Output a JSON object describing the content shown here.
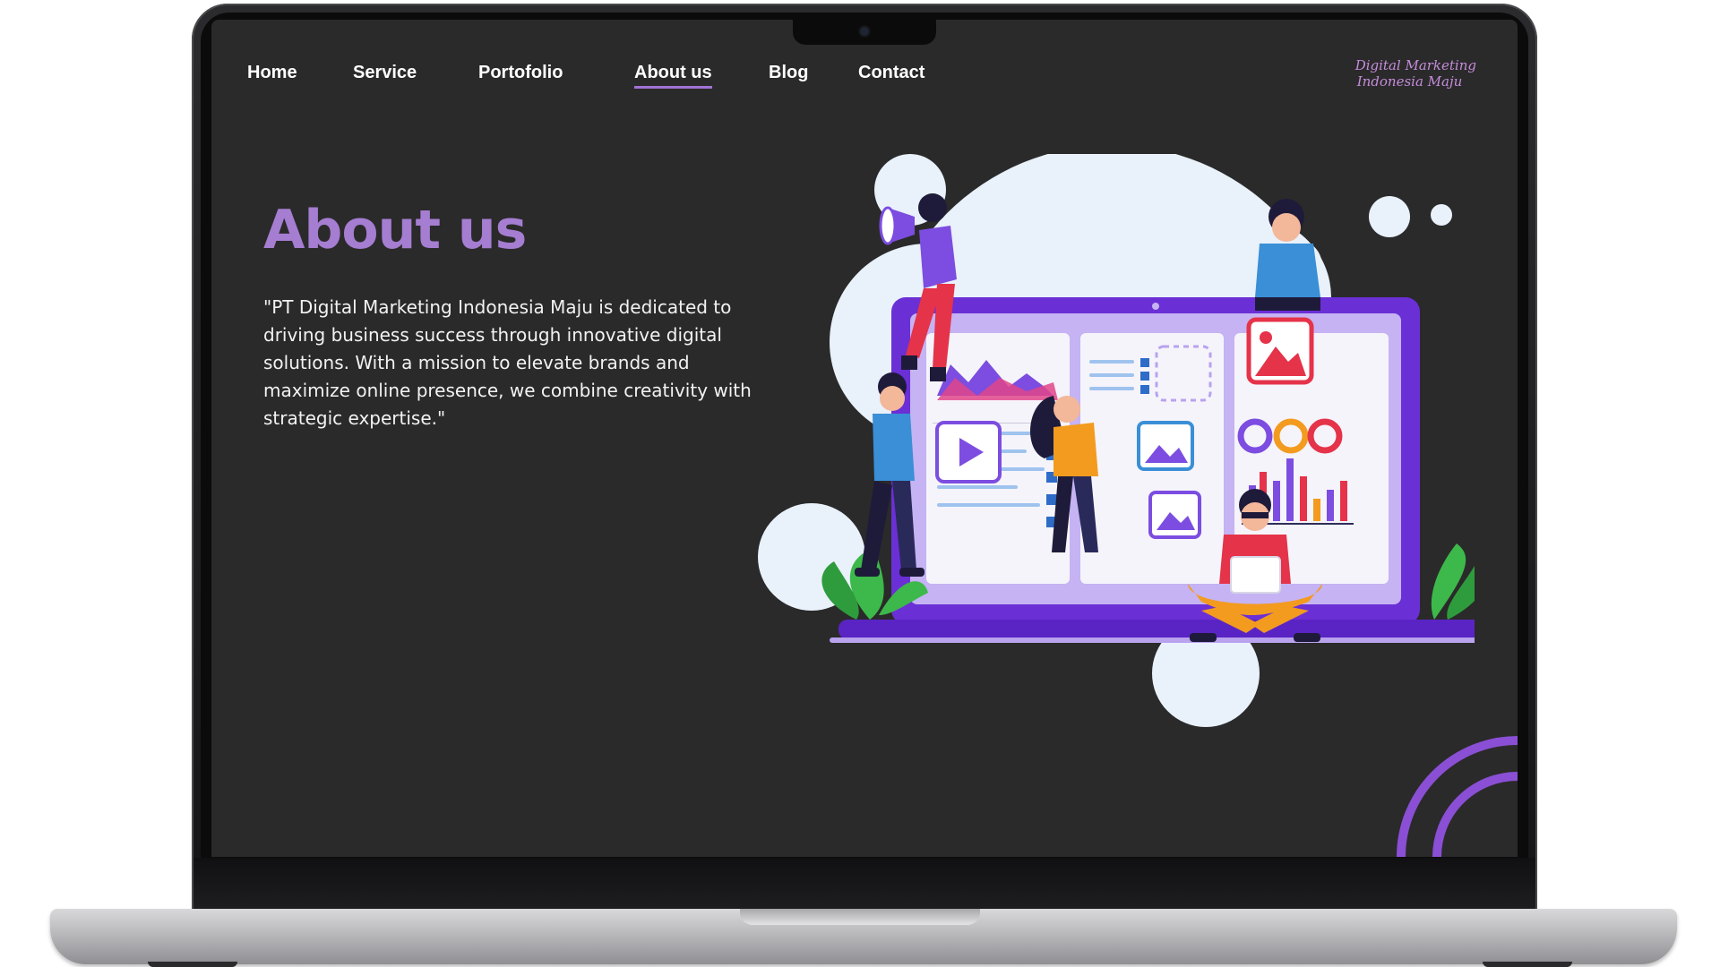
{
  "nav": {
    "items": [
      {
        "label": "Home"
      },
      {
        "label": "Service"
      },
      {
        "label": "Portofolio"
      },
      {
        "label": "About us",
        "active": true
      },
      {
        "label": "Blog"
      },
      {
        "label": "Contact"
      }
    ]
  },
  "brand": {
    "line1": "Digital Marketing",
    "line2": "Indonesia Maju"
  },
  "hero": {
    "title": "About us",
    "description": "\"PT Digital Marketing Indonesia Maju is dedicated to driving business success through innovative digital solutions. With a mission to elevate brands and maximize online presence, we combine creativity with strategic expertise.\""
  },
  "colors": {
    "screen_bg": "#2a2a2a",
    "accent": "#a57dd1",
    "brand": "#c58cdb",
    "illustration_purple": "#6b2fd6",
    "blob": "#e9f1fb"
  }
}
